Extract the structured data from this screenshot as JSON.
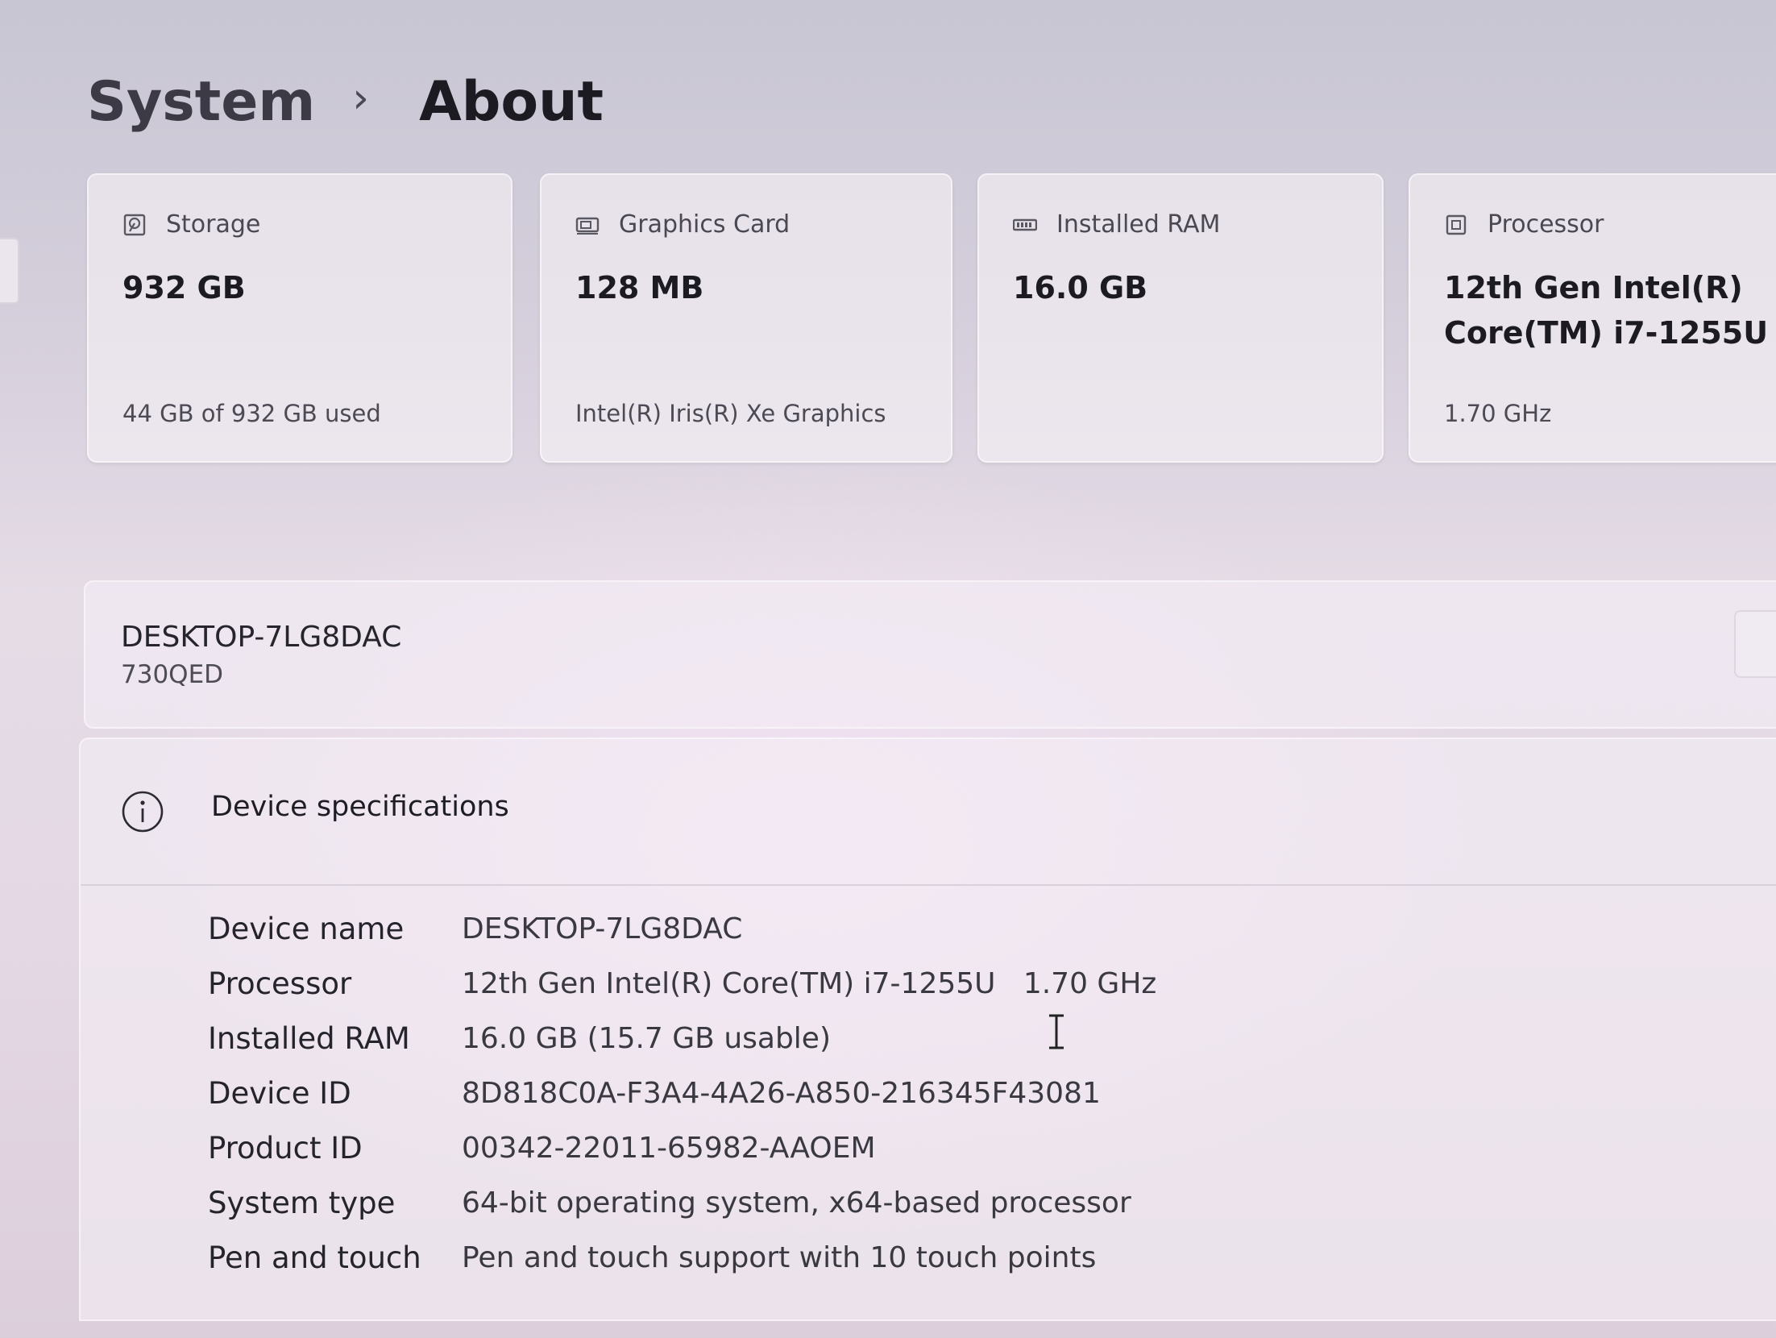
{
  "breadcrumb": {
    "parent": "System",
    "separator": "›",
    "current": "About"
  },
  "cards": [
    {
      "icon": "storage-icon",
      "title": "Storage",
      "value": "932 GB",
      "sub": "44 GB of 932 GB used"
    },
    {
      "icon": "graphics-card-icon",
      "title": "Graphics Card",
      "value": "128 MB",
      "sub": "Intel(R) Iris(R) Xe Graphics"
    },
    {
      "icon": "ram-icon",
      "title": "Installed RAM",
      "value": "16.0 GB",
      "sub": ""
    },
    {
      "icon": "processor-icon",
      "title": "Processor",
      "value_line1": "12th Gen Intel(R)",
      "value_line2": "Core(TM) i7-1255U",
      "sub": "1.70 GHz"
    }
  ],
  "device": {
    "name": "DESKTOP-7LG8DAC",
    "model": "730QED"
  },
  "specs": {
    "title": "Device specifications",
    "rows": [
      {
        "label": "Device name",
        "value": "DESKTOP-7LG8DAC"
      },
      {
        "label": "Processor",
        "value": "12th Gen Intel(R) Core(TM) i7-1255U   1.70 GHz"
      },
      {
        "label": "Installed RAM",
        "value": "16.0 GB (15.7 GB usable)"
      },
      {
        "label": "Device ID",
        "value": "8D818C0A-F3A4-4A26-A850-216345F43081"
      },
      {
        "label": "Product ID",
        "value": "00342-22011-65982-AAOEM"
      },
      {
        "label": "System type",
        "value": "64-bit operating system, x64-based processor"
      },
      {
        "label": "Pen and touch",
        "value": "Pen and touch support with 10 touch points"
      }
    ]
  }
}
